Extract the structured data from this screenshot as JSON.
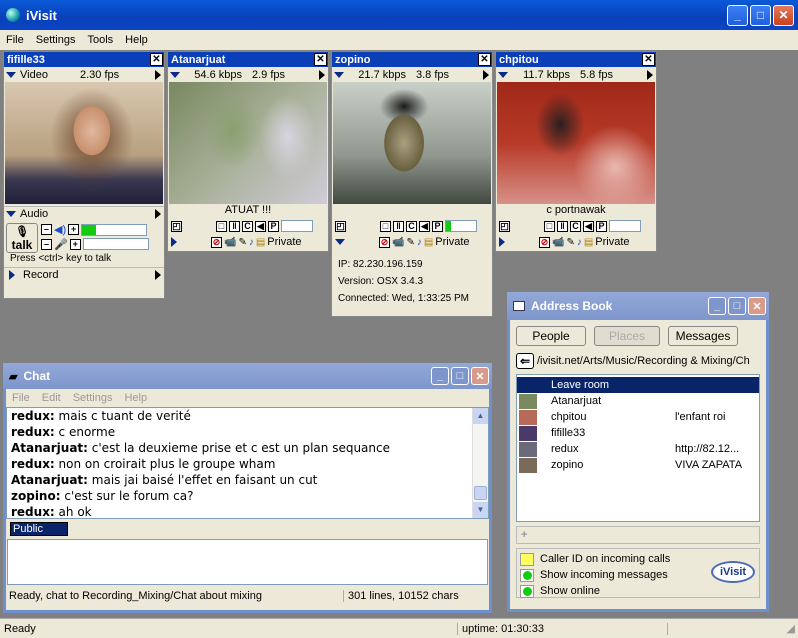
{
  "app": {
    "title": "iVisit",
    "menu": [
      "File",
      "Settings",
      "Tools",
      "Help"
    ]
  },
  "videos": [
    {
      "name": "fifille33",
      "mode": "Video",
      "fps": "2.30 fps",
      "audio_label": "Audio",
      "talk_label": "talk",
      "hint": "Press <ctrl> key to talk",
      "record_label": "Record"
    },
    {
      "name": "Atanarjuat",
      "rate": "54.6 kbps",
      "fps": "2.9 fps",
      "caption": "ATUAT !!!",
      "private_label": "Private"
    },
    {
      "name": "zopino",
      "rate": "21.7 kbps",
      "fps": "3.8 fps",
      "caption": "",
      "private_label": "Private",
      "info": {
        "ip": "IP: 82.230.196.159",
        "version": "Version: OSX 3.4.3",
        "connected": "Connected: Wed, 1:33:25  PM"
      }
    },
    {
      "name": "chpitou",
      "rate": "11.7 kbps",
      "fps": "5.8 fps",
      "caption": "c portnawak",
      "private_label": "Private"
    }
  ],
  "chat": {
    "title": "Chat",
    "menu": [
      "File",
      "Edit",
      "Settings",
      "Help"
    ],
    "lines": [
      {
        "user": "redux:",
        "text": " mais c tuant de verité"
      },
      {
        "user": "redux:",
        "text": " c enorme"
      },
      {
        "user": "Atanarjuat:",
        "text": " c'est la deuxieme prise et c est un plan sequance"
      },
      {
        "user": "redux:",
        "text": " non on croirait plus le groupe wham"
      },
      {
        "user": "Atanarjuat:",
        "text": " mais jai baisé l'effet en faisant un cut"
      },
      {
        "user": "zopino:",
        "text": " c'est sur le forum ca?"
      },
      {
        "user": "redux:",
        "text": " ah ok"
      }
    ],
    "channel": "Public",
    "status": "Ready, chat to Recording_Mixing/Chat about mixing",
    "stats": "301 lines, 10152 chars"
  },
  "address_book": {
    "title": "Address Book",
    "tabs": [
      "People",
      "Places",
      "Messages"
    ],
    "path": "/ivisit.net/Arts/Music/Recording & Mixing/Ch",
    "entries": [
      {
        "name": "Leave room",
        "note": "",
        "color": "#0a246a"
      },
      {
        "name": "Atanarjuat",
        "note": "",
        "color": "#7a8a60"
      },
      {
        "name": "chpitou",
        "note": "l'enfant roi",
        "color": "#b86a5a"
      },
      {
        "name": "fifille33",
        "note": "",
        "color": "#4a3a6a"
      },
      {
        "name": "redux",
        "note": "http://82.12...",
        "color": "#6a6a7a"
      },
      {
        "name": "zopino",
        "note": "VIVA ZAPATA",
        "color": "#7a6a5a"
      }
    ],
    "options": [
      "Caller ID on incoming calls",
      "Show incoming messages",
      "Show online"
    ],
    "logo": "iVisit"
  },
  "statusbar": {
    "left": "Ready",
    "uptime": "uptime: 01:30:33"
  }
}
